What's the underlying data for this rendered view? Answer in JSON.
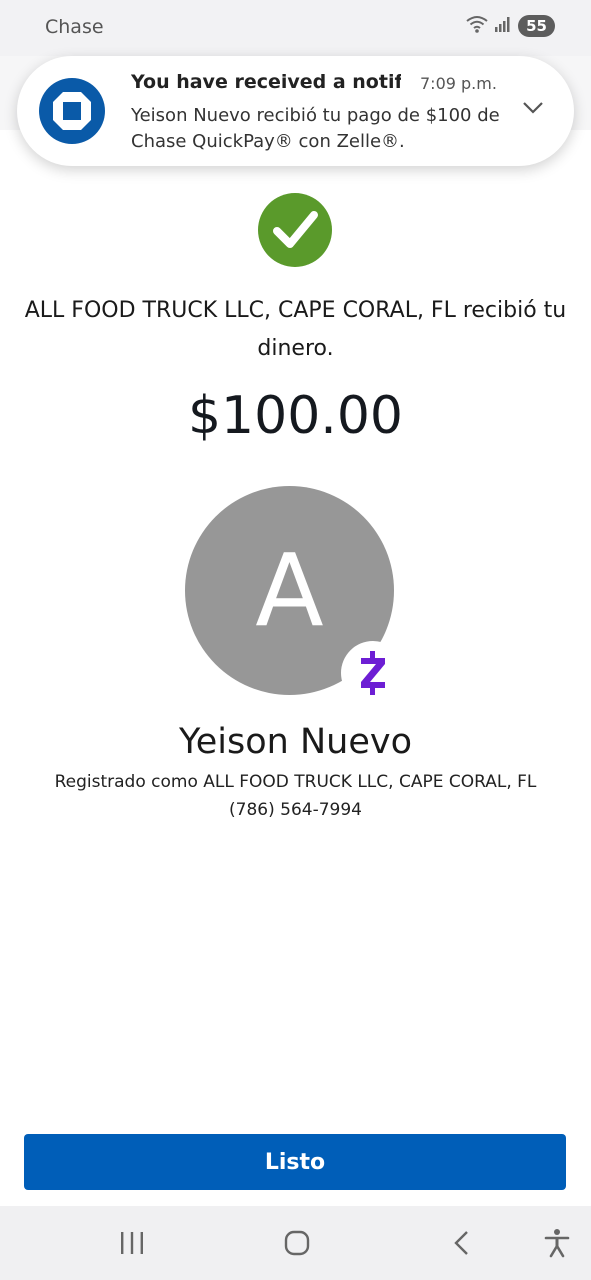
{
  "status_bar": {
    "carrier": "Chase",
    "battery": "55",
    "icons": [
      "wifi-icon",
      "signal-icon"
    ]
  },
  "notification": {
    "icon": "chase-logo-icon",
    "title": "You have received a notifi...",
    "time": "7:09 p.m.",
    "body": "Yeison Nuevo recibió tu pago de $100 de Chase QuickPay® con Zelle®."
  },
  "confirmation": {
    "status_icon": "check-icon",
    "message": "ALL FOOD TRUCK LLC, CAPE CORAL, FL recibió tu dinero.",
    "amount": "$100.00"
  },
  "recipient": {
    "avatar_letter": "A",
    "badge_icon": "zelle-icon",
    "name": "Yeison Nuevo",
    "registered_as": "Registrado como ALL FOOD TRUCK LLC, CAPE CORAL, FL",
    "phone": "(786) 564-7994"
  },
  "actions": {
    "done_label": "Listo"
  },
  "nav_bar": {
    "buttons": [
      "recents-icon",
      "home-icon",
      "back-icon",
      "accessibility-icon"
    ]
  },
  "colors": {
    "primary_button": "#005eb8",
    "success": "#5a9a2b",
    "zelle": "#6d1ed4",
    "avatar": "#979797",
    "chase_blue": "#0a5aa8"
  }
}
